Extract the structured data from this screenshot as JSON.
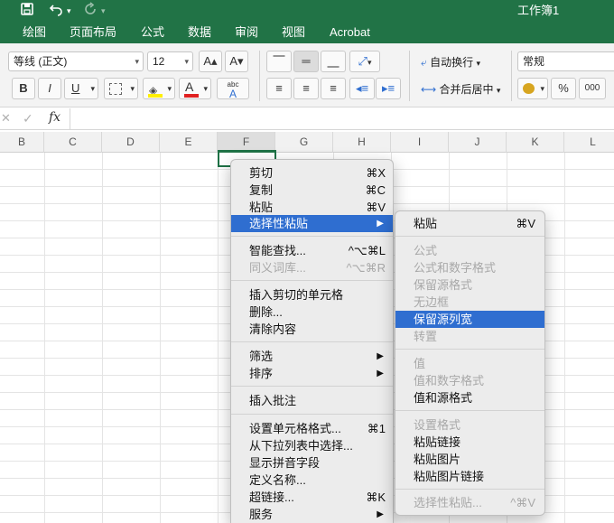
{
  "window": {
    "title": "工作簿1"
  },
  "titlebar_icons": [
    "save-icon",
    "undo-icon",
    "dropdown-arrow-icon",
    "redo-icon",
    "dropdown-arrow-icon"
  ],
  "tabs": [
    "绘图",
    "页面布局",
    "公式",
    "数据",
    "审阅",
    "视图",
    "Acrobat"
  ],
  "ribbon": {
    "font_name": "等线 (正文)",
    "font_size": "12",
    "grow_font": "A▴",
    "shrink_font": "A▾",
    "bold": "B",
    "italic": "I",
    "underline": "U",
    "wrap_text": "自动换行",
    "merge_center": "合并后居中",
    "number_format": "常规",
    "percent": "%",
    "comma": "000",
    "phonetic_label": "abc",
    "font_color_letter": "A",
    "colors": {
      "fill": "#ffef00",
      "font": "#e02020",
      "accent": "#217346"
    }
  },
  "formula_bar": {
    "cancel": "✕",
    "confirm": "✓",
    "fx": "fx"
  },
  "columns": [
    "B",
    "C",
    "D",
    "E",
    "F",
    "G",
    "H",
    "I",
    "J",
    "K",
    "L"
  ],
  "context_menu": {
    "items": [
      {
        "label": "剪切",
        "shortcut": "⌘X",
        "disabled": false
      },
      {
        "label": "复制",
        "shortcut": "⌘C",
        "disabled": false
      },
      {
        "label": "粘贴",
        "shortcut": "⌘V",
        "disabled": false
      },
      {
        "label": "选择性粘贴",
        "shortcut": "▶",
        "disabled": false,
        "highlighted": true
      },
      {
        "label": "智能查找...",
        "shortcut": "^⌥⌘L",
        "disabled": false
      },
      {
        "label": "同义词库...",
        "shortcut": "^⌥⌘R",
        "disabled": true
      },
      {
        "label": "插入剪切的单元格",
        "shortcut": "",
        "disabled": false
      },
      {
        "label": "删除...",
        "shortcut": "",
        "disabled": false
      },
      {
        "label": "清除内容",
        "shortcut": "",
        "disabled": false
      },
      {
        "label": "筛选",
        "shortcut": "▶",
        "disabled": false
      },
      {
        "label": "排序",
        "shortcut": "▶",
        "disabled": false
      },
      {
        "label": "插入批注",
        "shortcut": "",
        "disabled": false
      },
      {
        "label": "设置单元格格式...",
        "shortcut": "⌘1",
        "disabled": false
      },
      {
        "label": "从下拉列表中选择...",
        "shortcut": "",
        "disabled": false
      },
      {
        "label": "显示拼音字段",
        "shortcut": "",
        "disabled": false
      },
      {
        "label": "定义名称...",
        "shortcut": "",
        "disabled": false
      },
      {
        "label": "超链接...",
        "shortcut": "⌘K",
        "disabled": false
      },
      {
        "label": "服务",
        "shortcut": "▶",
        "disabled": false
      }
    ]
  },
  "submenu": {
    "items": [
      {
        "label": "粘贴",
        "shortcut": "⌘V",
        "disabled": false
      },
      {
        "label": "公式",
        "shortcut": "",
        "disabled": true
      },
      {
        "label": "公式和数字格式",
        "shortcut": "",
        "disabled": true
      },
      {
        "label": "保留源格式",
        "shortcut": "",
        "disabled": true
      },
      {
        "label": "无边框",
        "shortcut": "",
        "disabled": true
      },
      {
        "label": "保留源列宽",
        "shortcut": "",
        "disabled": false,
        "highlighted": true
      },
      {
        "label": "转置",
        "shortcut": "",
        "disabled": true
      },
      {
        "label": "值",
        "shortcut": "",
        "disabled": true
      },
      {
        "label": "值和数字格式",
        "shortcut": "",
        "disabled": true
      },
      {
        "label": "值和源格式",
        "shortcut": "",
        "disabled": false
      },
      {
        "label": "设置格式",
        "shortcut": "",
        "disabled": true
      },
      {
        "label": "粘贴链接",
        "shortcut": "",
        "disabled": false
      },
      {
        "label": "粘贴图片",
        "shortcut": "",
        "disabled": false
      },
      {
        "label": "粘贴图片链接",
        "shortcut": "",
        "disabled": false
      },
      {
        "label": "选择性粘贴...",
        "shortcut": "^⌘V",
        "disabled": true
      }
    ]
  }
}
